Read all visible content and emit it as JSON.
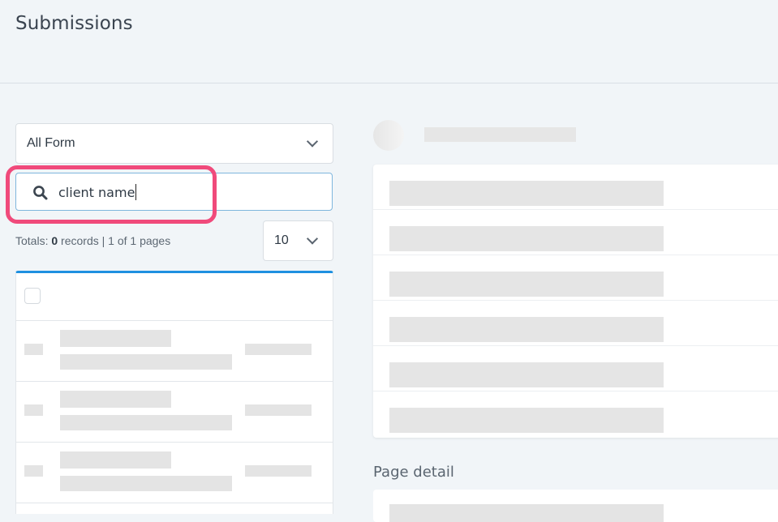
{
  "page": {
    "title": "Submissions"
  },
  "filters": {
    "form_select_value": "All Form",
    "search_value": "client name",
    "totals_label": "Totals:",
    "totals_count": "0",
    "totals_suffix": "records | 1 of 1 pages",
    "per_page_value": "10"
  },
  "detail": {
    "section_title": "Page detail"
  },
  "icons": {
    "search": "search-icon",
    "dropdown": "chevron-down-icon"
  },
  "colors": {
    "accent": "#1e90e0",
    "highlight": "#f04a7b",
    "background": "#f1f5f8"
  }
}
